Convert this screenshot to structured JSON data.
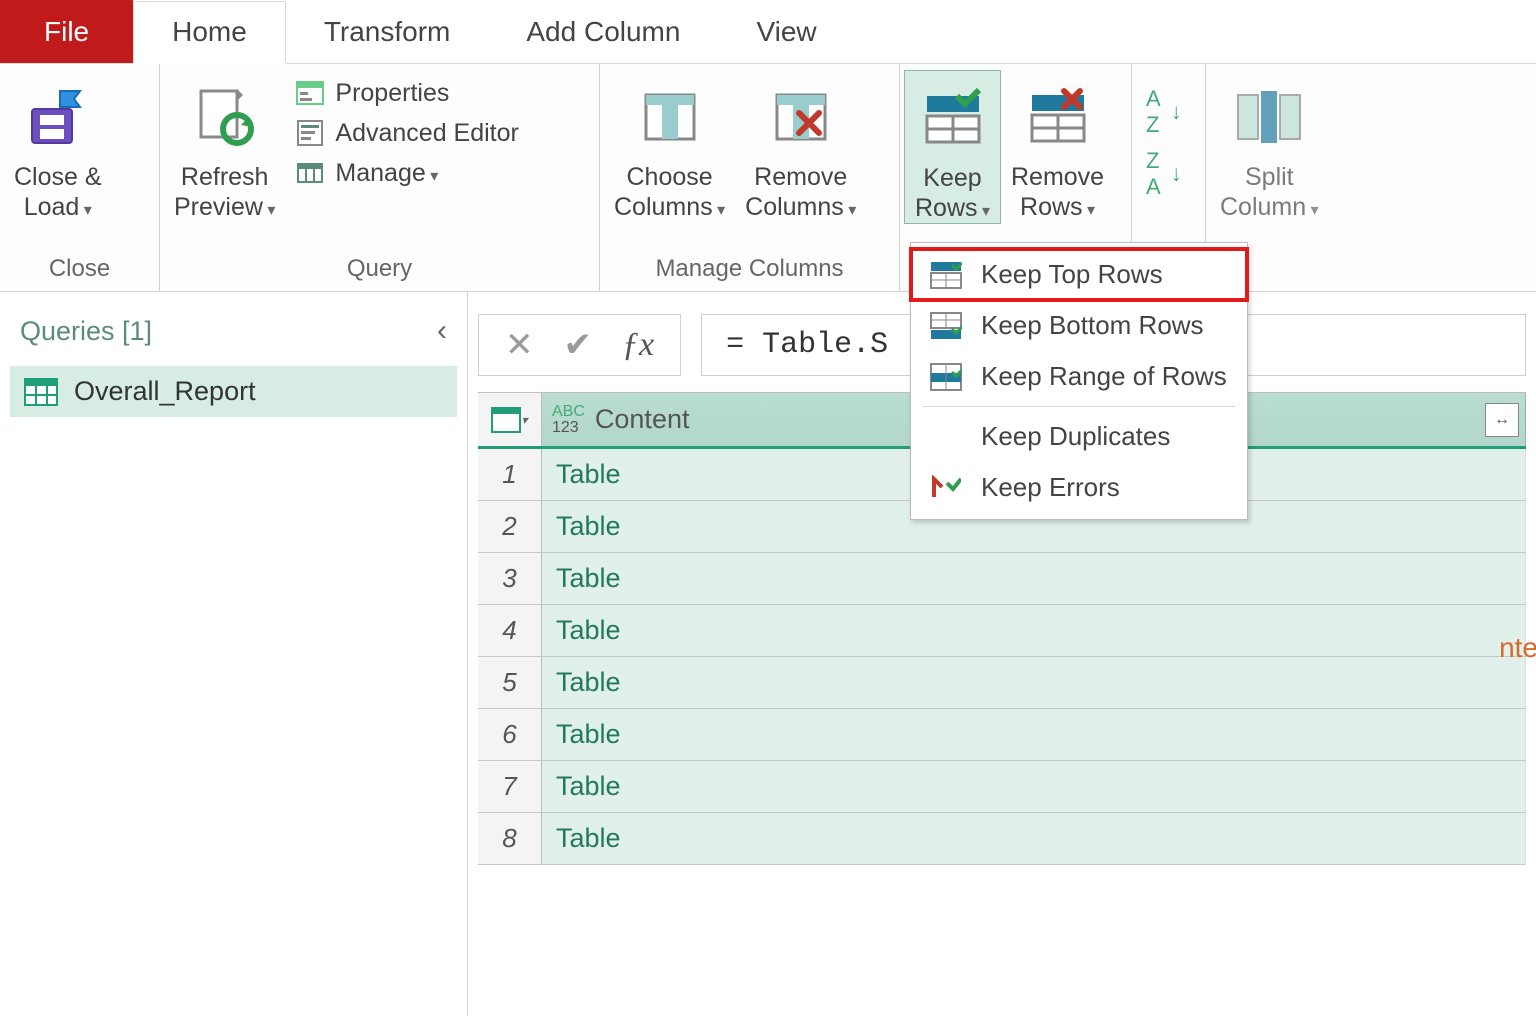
{
  "tabs": {
    "file": "File",
    "home": "Home",
    "transform": "Transform",
    "addcol": "Add Column",
    "view": "View"
  },
  "ribbon": {
    "close_group": "Close",
    "close_load": "Close &\nLoad",
    "query_group": "Query",
    "refresh": "Refresh\nPreview",
    "properties": "Properties",
    "advanced": "Advanced Editor",
    "manage": "Manage",
    "manage_cols_group": "Manage Columns",
    "choose_cols": "Choose\nColumns",
    "remove_cols": "Remove\nColumns",
    "keep_rows": "Keep\nRows",
    "remove_rows": "Remove\nRows",
    "split_col": "Split\nColumn",
    "sort_az": "A→Z",
    "sort_za": "Z→A"
  },
  "dropdown": {
    "top": "Keep Top Rows",
    "bottom": "Keep Bottom Rows",
    "range": "Keep Range of Rows",
    "dup": "Keep Duplicates",
    "err": "Keep Errors"
  },
  "side": {
    "header": "Queries [1]",
    "item": "Overall_Report"
  },
  "formula": "= Table.S",
  "grid": {
    "column": "Content",
    "rows": [
      {
        "n": "1",
        "v": "Table"
      },
      {
        "n": "2",
        "v": "Table"
      },
      {
        "n": "3",
        "v": "Table"
      },
      {
        "n": "4",
        "v": "Table"
      },
      {
        "n": "5",
        "v": "Table"
      },
      {
        "n": "6",
        "v": "Table"
      },
      {
        "n": "7",
        "v": "Table"
      },
      {
        "n": "8",
        "v": "Table"
      }
    ]
  },
  "right_peek": "nte"
}
